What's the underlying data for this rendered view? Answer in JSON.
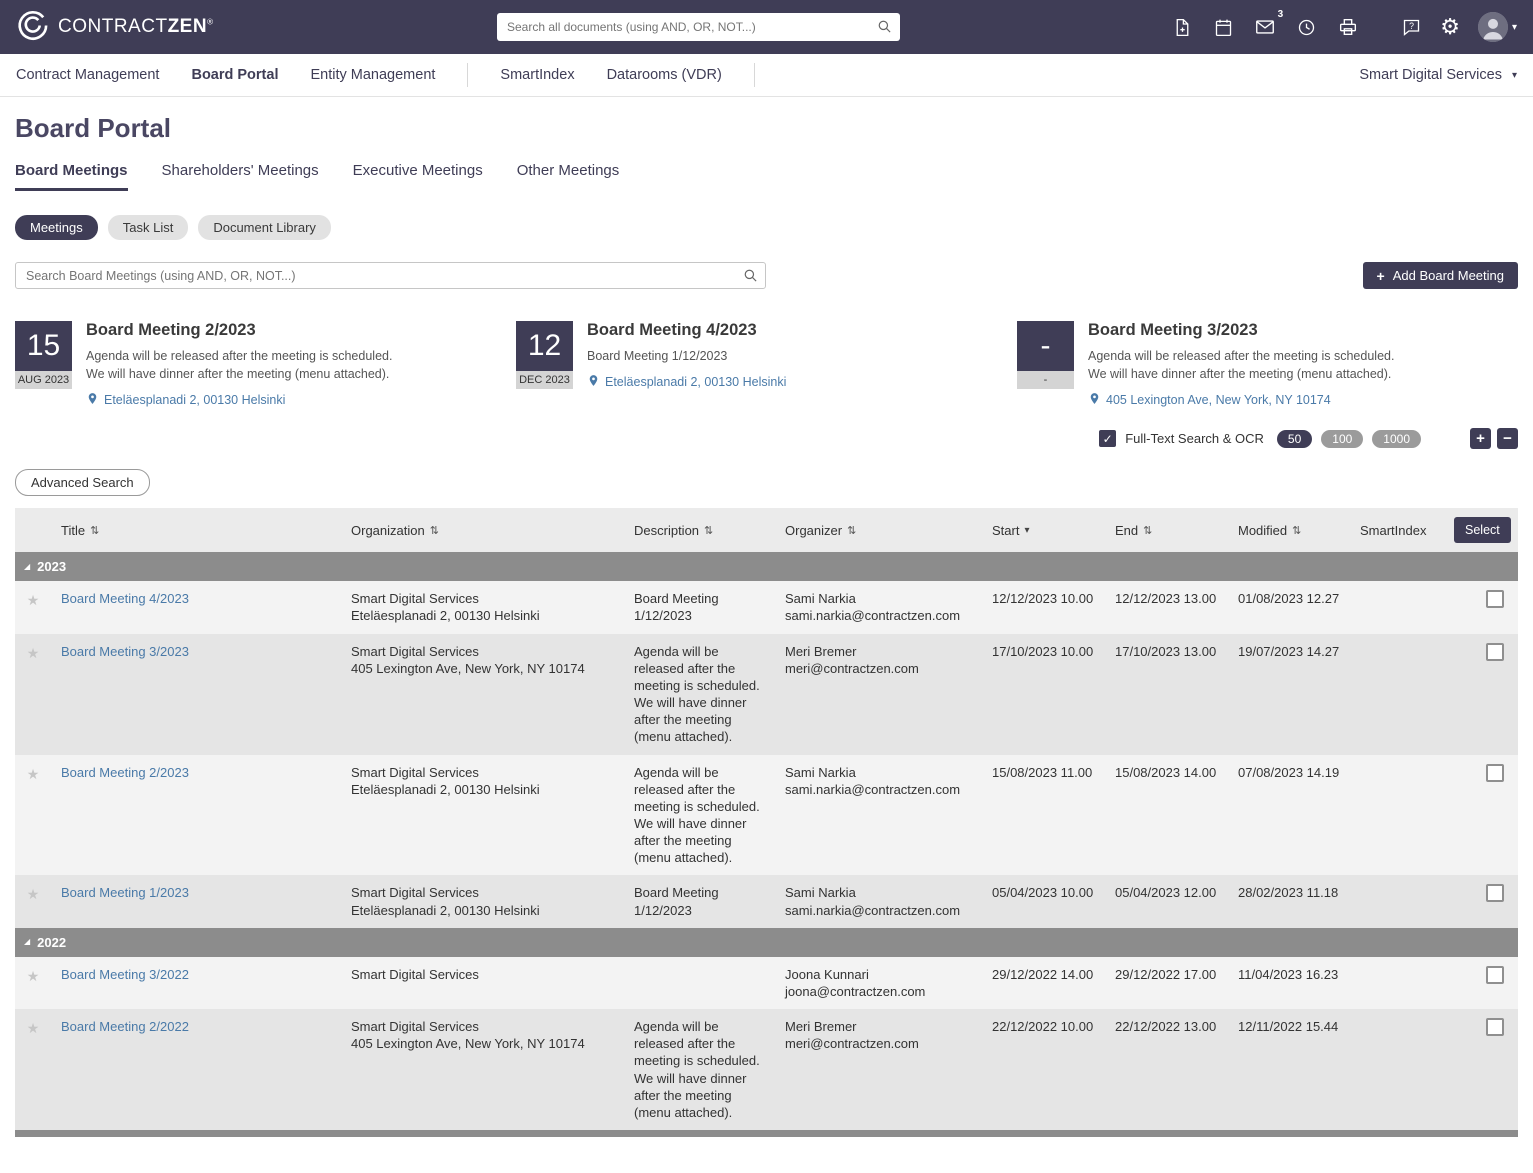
{
  "colors": {
    "brand": "#3f3d56",
    "link": "#4a7aa8",
    "group_bar": "#8c8c8c"
  },
  "topbar": {
    "logo_text_1": "CONTRACT",
    "logo_text_2": "ZEN",
    "logo_reg": "®",
    "search_placeholder": "Search all documents (using AND, OR, NOT...)",
    "mail_badge": "3"
  },
  "nav": {
    "items": [
      {
        "label": "Contract Management"
      },
      {
        "label": "Board Portal"
      },
      {
        "label": "Entity Management"
      },
      {
        "label": "SmartIndex"
      },
      {
        "label": "Datarooms (VDR)"
      }
    ],
    "tenant": "Smart Digital Services"
  },
  "page": {
    "title": "Board Portal",
    "tabs": [
      {
        "label": "Board Meetings"
      },
      {
        "label": "Shareholders' Meetings"
      },
      {
        "label": "Executive Meetings"
      },
      {
        "label": "Other Meetings"
      }
    ],
    "view_pills": [
      {
        "label": "Meetings"
      },
      {
        "label": "Task List"
      },
      {
        "label": "Document Library"
      }
    ],
    "search_placeholder": "Search Board Meetings (using AND, OR, NOT...)",
    "add_button_label": "Add Board Meeting"
  },
  "cards": [
    {
      "day": "15",
      "month_year": "AUG 2023",
      "title": "Board Meeting 2/2023",
      "desc": "Agenda will be released after the meeting is scheduled.\nWe will have dinner after the meeting (menu attached).",
      "location": "Eteläesplanadi 2, 00130 Helsinki"
    },
    {
      "day": "12",
      "month_year": "DEC 2023",
      "title": "Board Meeting 4/2023",
      "desc": "Board Meeting 1/12/2023",
      "location": "Eteläesplanadi 2, 00130 Helsinki"
    },
    {
      "day": "-",
      "month_year": "-",
      "title": "Board Meeting 3/2023",
      "desc": "Agenda will be released after the meeting is scheduled.\nWe will have dinner after the meeting (menu attached).",
      "location": "405 Lexington Ave, New York, NY 10174"
    }
  ],
  "controls": {
    "fulltext_label": "Full-Text Search & OCR",
    "page_sizes": [
      "50",
      "100",
      "1000"
    ],
    "active_page_size": "50",
    "plus_label": "+",
    "minus_label": "−",
    "advanced_search_label": "Advanced Search",
    "select_label": "Select"
  },
  "table": {
    "columns": [
      "Title",
      "Organization",
      "Description",
      "Organizer",
      "Start",
      "End",
      "Modified",
      "SmartIndex"
    ],
    "groups": [
      {
        "label": "2023",
        "rows": [
          {
            "title": "Board Meeting 4/2023",
            "org": "Smart Digital Services",
            "org_address": "Eteläesplanadi 2, 00130 Helsinki",
            "description": "Board Meeting 1/12/2023",
            "organizer": "Sami Narkia",
            "organizer_email": "sami.narkia@contractzen.com",
            "start": "12/12/2023 10.00",
            "end": "12/12/2023 13.00",
            "modified": "01/08/2023 12.27"
          },
          {
            "title": "Board Meeting 3/2023",
            "org": "Smart Digital Services",
            "org_address": "405 Lexington Ave, New York, NY 10174",
            "description": "Agenda will be released after the meeting is scheduled. We will have dinner after the meeting (menu attached).",
            "organizer": "Meri Bremer",
            "organizer_email": "meri@contractzen.com",
            "start": "17/10/2023 10.00",
            "end": "17/10/2023 13.00",
            "modified": "19/07/2023 14.27"
          },
          {
            "title": "Board Meeting 2/2023",
            "org": "Smart Digital Services",
            "org_address": "Eteläesplanadi 2, 00130 Helsinki",
            "description": "Agenda will be released after the meeting is scheduled. We will have dinner after the meeting (menu attached).",
            "organizer": "Sami Narkia",
            "organizer_email": "sami.narkia@contractzen.com",
            "start": "15/08/2023 11.00",
            "end": "15/08/2023 14.00",
            "modified": "07/08/2023 14.19"
          },
          {
            "title": "Board Meeting 1/2023",
            "org": "Smart Digital Services",
            "org_address": "Eteläesplanadi 2, 00130 Helsinki",
            "description": "Board Meeting 1/12/2023",
            "organizer": "Sami Narkia",
            "organizer_email": "sami.narkia@contractzen.com",
            "start": "05/04/2023 10.00",
            "end": "05/04/2023 12.00",
            "modified": "28/02/2023 11.18"
          }
        ]
      },
      {
        "label": "2022",
        "rows": [
          {
            "title": "Board Meeting 3/2022",
            "org": "Smart Digital Services",
            "org_address": "",
            "description": "",
            "organizer": "Joona Kunnari",
            "organizer_email": "joona@contractzen.com",
            "start": "29/12/2022 14.00",
            "end": "29/12/2022 17.00",
            "modified": "11/04/2023 16.23"
          },
          {
            "title": "Board Meeting 2/2022",
            "org": "Smart Digital Services",
            "org_address": "405 Lexington Ave, New York, NY 10174",
            "description": "Agenda will be released after the meeting is scheduled. We will have dinner after the meeting (menu attached).",
            "organizer": "Meri Bremer",
            "organizer_email": "meri@contractzen.com",
            "start": "22/12/2022 10.00",
            "end": "22/12/2022 13.00",
            "modified": "12/11/2022 15.44"
          }
        ]
      }
    ]
  }
}
